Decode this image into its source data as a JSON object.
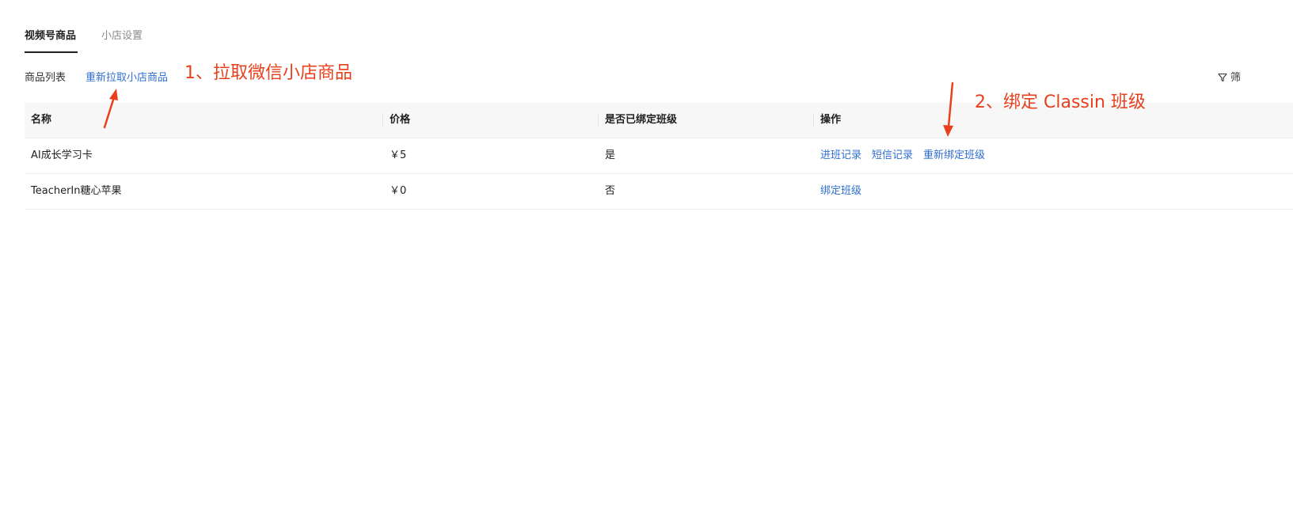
{
  "tabs": [
    {
      "label": "视频号商品",
      "active": true
    },
    {
      "label": "小店设置",
      "active": false
    }
  ],
  "toolbar": {
    "list_label": "商品列表",
    "refetch_label": "重新拉取小店商品",
    "filter_label": "筛"
  },
  "table": {
    "headers": [
      "名称",
      "价格",
      "是否已绑定班级",
      "操作"
    ],
    "rows": [
      {
        "name": "AI成长学习卡",
        "price": "￥5",
        "bound": "是",
        "actions": [
          "进班记录",
          "短信记录",
          "重新绑定班级"
        ]
      },
      {
        "name": "TeacherIn糖心苹果",
        "price": "￥0",
        "bound": "否",
        "actions": [
          "绑定班级"
        ]
      }
    ]
  },
  "annotations": [
    {
      "text": "1、拉取微信小店商品"
    },
    {
      "text": "2、绑定 Classin 班级"
    }
  ],
  "colors": {
    "accent_link": "#2f6fd0",
    "annotation_red": "#e8401c",
    "header_bg": "#f7f7f7"
  },
  "icons": {
    "filter": "filter-icon"
  }
}
